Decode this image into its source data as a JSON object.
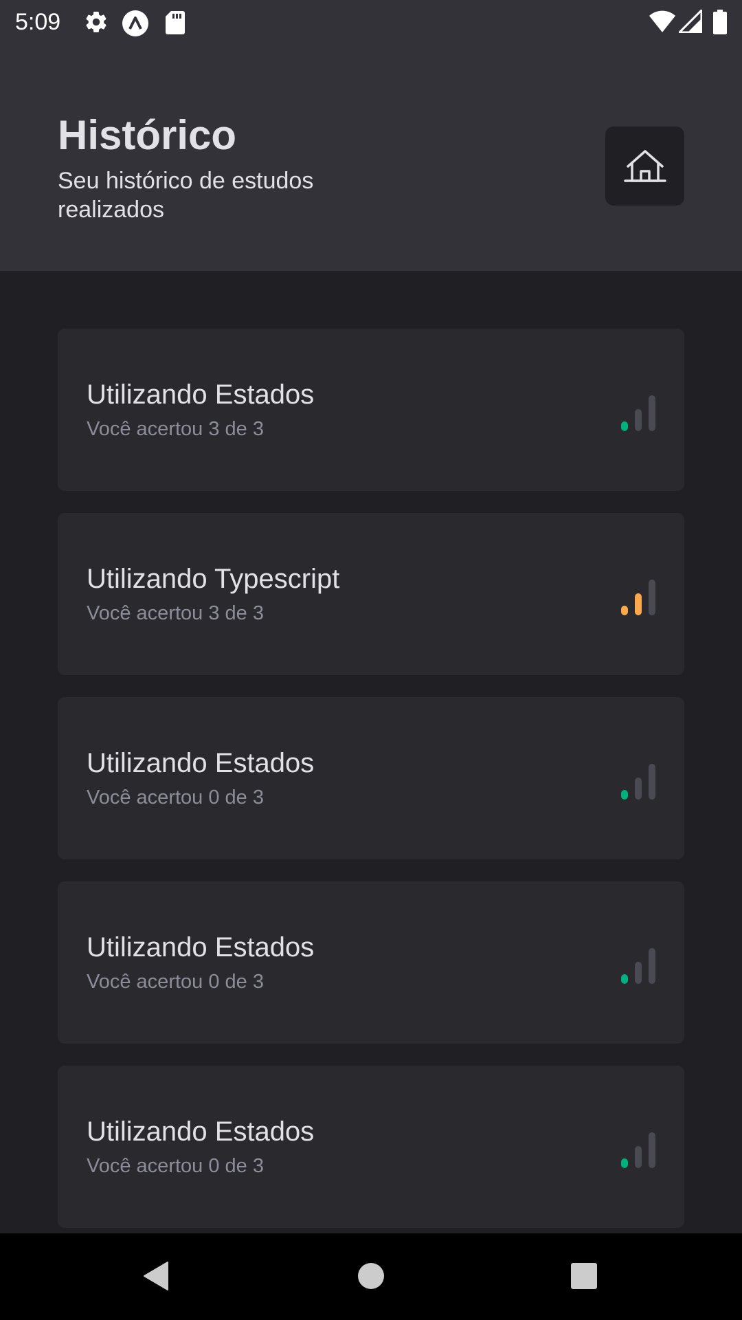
{
  "status_bar": {
    "time": "5:09",
    "icons": [
      "gear-icon",
      "vpn-app-icon",
      "sd-card-icon",
      "wifi-icon",
      "signal-icon",
      "battery-icon"
    ]
  },
  "header": {
    "title": "Histórico",
    "subtitle": "Seu histórico de estudos realizados",
    "home_button_icon": "house-icon"
  },
  "history": [
    {
      "title": "Utilizando Estados",
      "result": "Você acertou 3 de 3",
      "level": 1,
      "level_color": "#00b37e"
    },
    {
      "title": "Utilizando Typescript",
      "result": "Você acertou 3 de 3",
      "level": 2,
      "level_color": "#fba94c"
    },
    {
      "title": "Utilizando Estados",
      "result": "Você acertou 0 de 3",
      "level": 1,
      "level_color": "#00b37e"
    },
    {
      "title": "Utilizando Estados",
      "result": "Você acertou 0 de 3",
      "level": 1,
      "level_color": "#00b37e"
    },
    {
      "title": "Utilizando Estados",
      "result": "Você acertou 0 de 3",
      "level": 1,
      "level_color": "#00b37e"
    }
  ],
  "nav_bar": {
    "back_icon": "back-triangle-icon",
    "home_icon": "home-circle-icon",
    "recents_icon": "recents-square-icon"
  },
  "colors": {
    "background": "#202024",
    "header": "#323238",
    "card": "#29292e",
    "text_primary": "#e1e1e6",
    "text_secondary": "#8d8d99",
    "level_inactive": "#4a4a52"
  }
}
